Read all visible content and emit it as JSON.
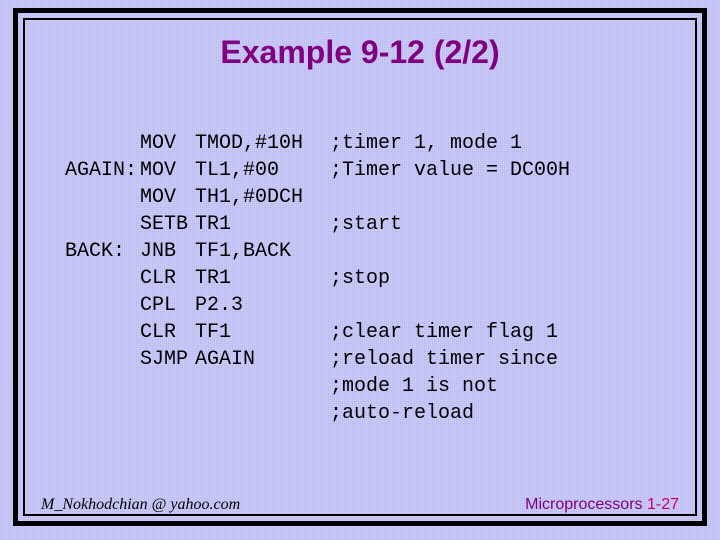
{
  "title": "Example 9-12 (2/2)",
  "code": {
    "rows": [
      {
        "label": "",
        "op": "MOV",
        "arg": "TMOD,#10H",
        "cmt": ";timer 1, mode 1"
      },
      {
        "label": "AGAIN:",
        "op": "MOV",
        "arg": "TL1,#00",
        "cmt": ";Timer value = DC00H"
      },
      {
        "label": "",
        "op": "MOV",
        "arg": "TH1,#0DCH",
        "cmt": ""
      },
      {
        "label": "",
        "op": "SETB",
        "arg": "TR1",
        "cmt": ";start"
      },
      {
        "label": "BACK:",
        "op": "JNB",
        "arg": "TF1,BACK",
        "cmt": ""
      },
      {
        "label": "",
        "op": "CLR",
        "arg": "TR1",
        "cmt": ";stop"
      },
      {
        "label": "",
        "op": "CPL",
        "arg": "P2.3",
        "cmt": ""
      },
      {
        "label": "",
        "op": "CLR",
        "arg": "TF1",
        "cmt": ";clear timer flag 1"
      },
      {
        "label": "",
        "op": "SJMP",
        "arg": "AGAIN",
        "cmt": ";reload timer since"
      },
      {
        "label": "",
        "op": "",
        "arg": "",
        "cmt": ";mode 1 is not"
      },
      {
        "label": "",
        "op": "",
        "arg": "",
        "cmt": ";auto-reload"
      }
    ]
  },
  "footer": {
    "left": "M_Nokhodchian @ yahoo.com",
    "right_text": "Microprocessors ",
    "right_page": "1-27"
  }
}
